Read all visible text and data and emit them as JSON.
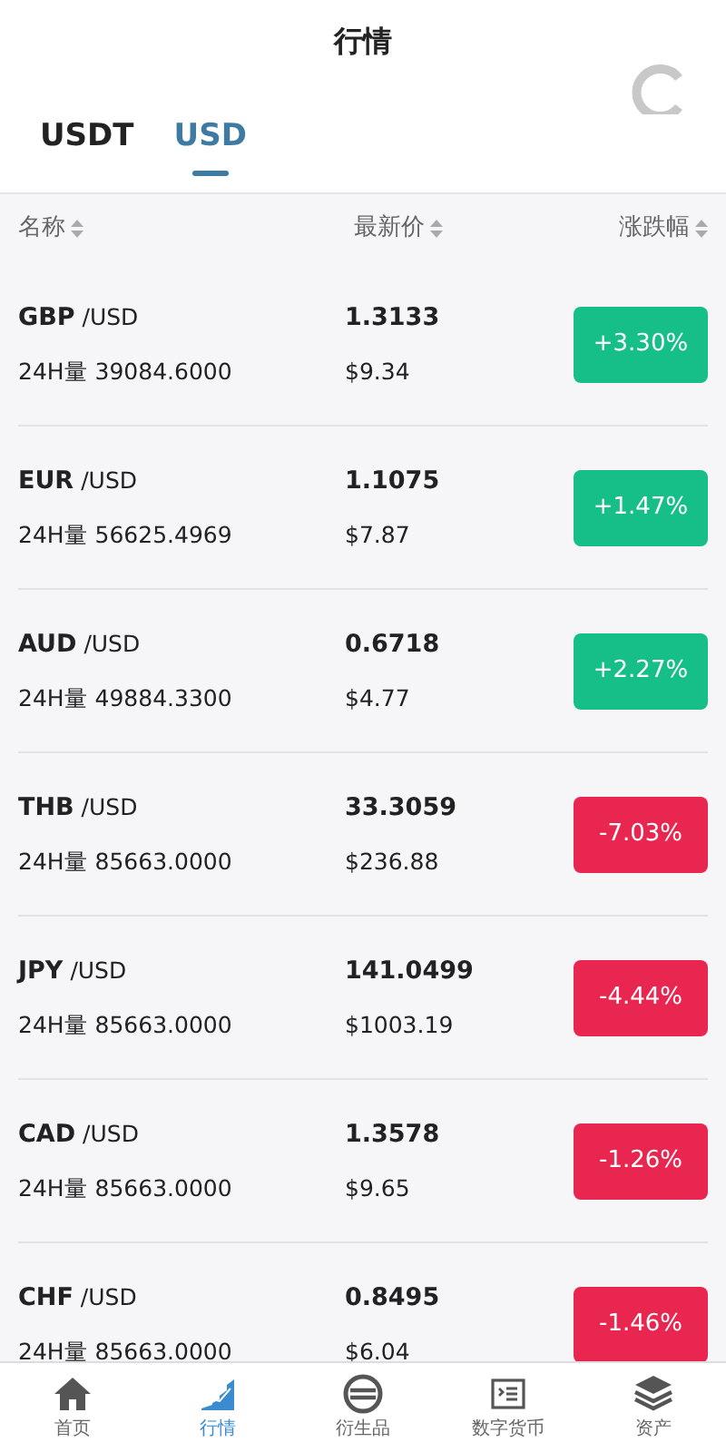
{
  "header": {
    "title": "行情"
  },
  "tabs": [
    {
      "label": "USDT",
      "selected": false
    },
    {
      "label": "USD",
      "selected": true
    }
  ],
  "table": {
    "columns": [
      "名称",
      "最新价",
      "涨跌幅"
    ],
    "rows": [
      {
        "symbol": "GBP",
        "quote": "/USD",
        "volume": "24H量 39084.6000",
        "price": "1.3133",
        "value": "$9.34",
        "change": "+3.30%",
        "kind": "up"
      },
      {
        "symbol": "EUR",
        "quote": "/USD",
        "volume": "24H量 56625.4969",
        "price": "1.1075",
        "value": "$7.87",
        "change": "+1.47%",
        "kind": "up"
      },
      {
        "symbol": "AUD",
        "quote": "/USD",
        "volume": "24H量 49884.3300",
        "price": "0.6718",
        "value": "$4.77",
        "change": "+2.27%",
        "kind": "up"
      },
      {
        "symbol": "THB",
        "quote": "/USD",
        "volume": "24H量 85663.0000",
        "price": "33.3059",
        "value": "$236.88",
        "change": "-7.03%",
        "kind": "down"
      },
      {
        "symbol": "JPY",
        "quote": "/USD",
        "volume": "24H量 85663.0000",
        "price": "141.0499",
        "value": "$1003.19",
        "change": "-4.44%",
        "kind": "down"
      },
      {
        "symbol": "CAD",
        "quote": "/USD",
        "volume": "24H量 85663.0000",
        "price": "1.3578",
        "value": "$9.65",
        "change": "-1.26%",
        "kind": "down"
      },
      {
        "symbol": "CHF",
        "quote": "/USD",
        "volume": "24H量 85663.0000",
        "price": "0.8495",
        "value": "$6.04",
        "change": "-1.46%",
        "kind": "down"
      }
    ]
  },
  "bottom_nav": [
    {
      "label": "首页",
      "selected": false
    },
    {
      "label": "行情",
      "selected": true
    },
    {
      "label": "衍生品",
      "selected": false
    },
    {
      "label": "数字货币",
      "selected": false
    },
    {
      "label": "资产",
      "selected": false
    }
  ]
}
